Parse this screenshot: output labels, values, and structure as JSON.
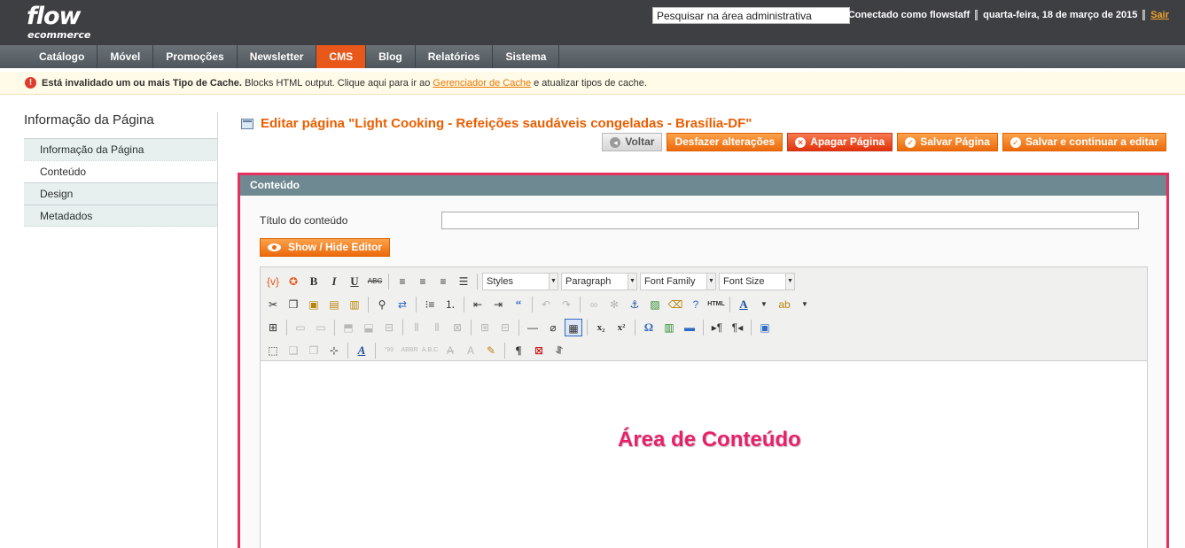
{
  "logo": {
    "line1": "flow",
    "line2": "ecommerce"
  },
  "header": {
    "search_value": "Pesquisar na área administrativa",
    "connected": "Conectado como flowstaff",
    "date": "quarta-feira, 18 de março de 2015",
    "logout": "Sair"
  },
  "nav": {
    "items": [
      "Catálogo",
      "Móvel",
      "Promoções",
      "Newsletter",
      "CMS",
      "Blog",
      "Relatórios",
      "Sistema"
    ],
    "active": "CMS"
  },
  "notice": {
    "bold": "Está invalidado um ou mais Tipo de Cache.",
    "text1": " Blocks HTML output. Clique aqui para ir ao ",
    "link": "Gerenciador de Cache",
    "text2": " e atualizar tipos de cache."
  },
  "sidebar": {
    "title": "Informação da Página",
    "tabs": [
      "Informação da Página",
      "Conteúdo",
      "Design",
      "Metadados"
    ],
    "active_tab": "Conteúdo"
  },
  "page": {
    "title": "Editar página \"Light Cooking - Refeições saudáveis congeladas - Brasília-DF\"",
    "buttons": {
      "back": "Voltar",
      "reset": "Desfazer alterações",
      "delete": "Apagar Página",
      "save": "Salvar Página",
      "save_continue": "Salvar e continuar a editar"
    }
  },
  "fieldset": {
    "heading": "Conteúdo",
    "content_title_label": "Título do conteúdo",
    "content_title_value": "",
    "toggle_editor": "Show / Hide Editor"
  },
  "editor": {
    "styles": "Styles",
    "paragraph": "Paragraph",
    "font_family": "Font Family",
    "font_size": "Font Size",
    "content_annotation": "Área de Conteúdo"
  },
  "colors": {
    "accent": "#eb5e00",
    "annotation": "#ea1f6a",
    "header_bg": "#3e3f43",
    "fieldset_head": "#6f8992"
  }
}
